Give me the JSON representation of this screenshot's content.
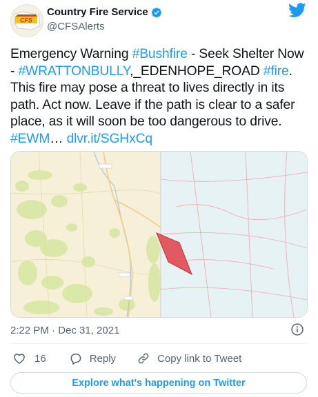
{
  "account": {
    "display_name": "Country Fire Service",
    "handle": "@CFSAlerts",
    "avatar_text": "CFS",
    "verified": true
  },
  "tweet": {
    "segments": [
      {
        "text": "Emergency Warning ",
        "link": false
      },
      {
        "text": "#Bushfire",
        "link": true
      },
      {
        "text": " - Seek Shelter Now - ",
        "link": false
      },
      {
        "text": "#WRATTONBULLY",
        "link": true
      },
      {
        "text": ",_EDENHOPE_ROAD ",
        "link": false
      },
      {
        "text": "#fire",
        "link": true
      },
      {
        "text": ". This fire may pose a threat to lives directly in its path. Act now. Leave if the path is clear to a safer place, as it will soon be too dangerous to drive. ",
        "link": false
      },
      {
        "text": "#EWM",
        "link": true
      },
      {
        "text": "… ",
        "link": false
      },
      {
        "text": "dlvr.it/SGHxCq",
        "link": true
      }
    ]
  },
  "map": {
    "left_region_color": "#f6f0d9",
    "right_region_color": "#e6f2f4",
    "vegetation_color": "#d9e7a6",
    "fire_zone_color": "#e0444d"
  },
  "meta": {
    "timestamp": "2:22 PM · Dec 31, 2021"
  },
  "actions": {
    "like_count": "16",
    "reply_label": "Reply",
    "copy_label": "Copy link to Tweet"
  },
  "explore": {
    "label": "Explore what's happening on Twitter"
  },
  "colors": {
    "accent": "#1d9bf0",
    "text": "#0f1419",
    "muted": "#536471",
    "border": "#cfd9de"
  }
}
